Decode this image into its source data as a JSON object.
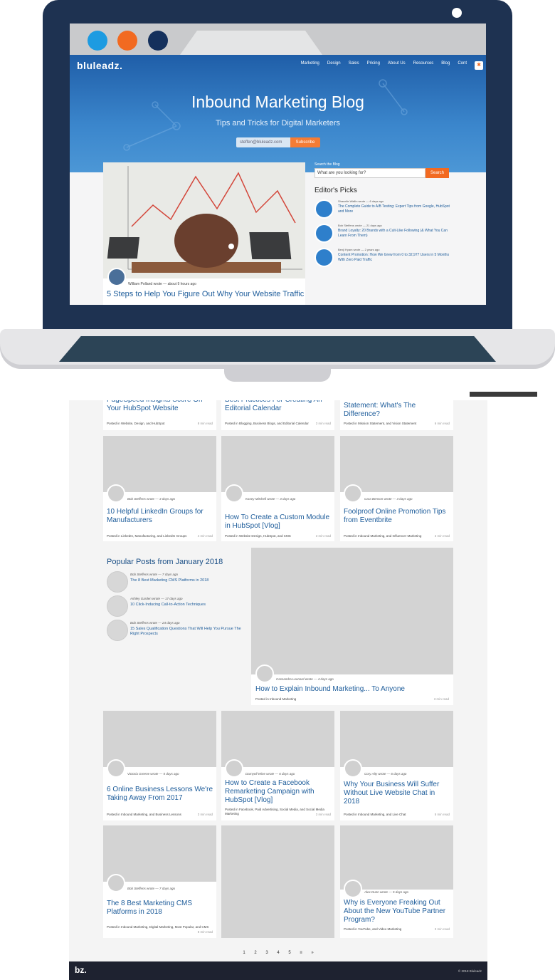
{
  "site": {
    "logo": "bluleadz.",
    "nav": [
      "Marketing",
      "Design",
      "Sales",
      "Pricing",
      "About Us",
      "Resources",
      "Blog",
      "Cont"
    ],
    "hub_icon": "hubspot-icon"
  },
  "hero": {
    "title": "Inbound Marketing Blog",
    "subtitle": "Tips and Tricks for Digital Marketers",
    "email_value": "steffen@bluleadz.com",
    "subscribe_label": "Subscribe"
  },
  "featured": {
    "byline": "William Polland wrote — about 9 hours ago",
    "title": "5 Steps to Help You Figure Out Why Your Website Traffic"
  },
  "sidebar": {
    "search_label": "Search the Blog",
    "search_placeholder": "What are you looking for?",
    "search_button": "Search",
    "picks_heading": "Editor's Picks",
    "picks": [
      {
        "author": "Shanelle Wallin wrote — 6 days ago",
        "title": "The Complete Guide to A/B Testing: Expert Tips from Google, HubSpot and More"
      },
      {
        "author": "Bob Steffens wrote — 21 days ago",
        "title": "Brand Loyalty: 20 Brands with a Cult-Like Following (& What You Can Learn From Them)"
      },
      {
        "author": "Benji Hyam wrote — 2 years ago",
        "title": "Content Promotion: How We Grew from 0 to 32,977 Users in 5 Months With Zero Paid Traffic"
      }
    ]
  },
  "top_row": [
    {
      "title": "PageSpeed Insights Score On Your HubSpot Website",
      "meta": "Posted in Website, Design, and HubSpot",
      "read": "8 min read"
    },
    {
      "title": "Best Practices For Creating An Editorial Calendar",
      "meta": "Posted in Blogging, Business Blogs, and Editorial Calendar",
      "read": "3 min read"
    },
    {
      "title": "Statement: What's The Difference?",
      "meta": "Posted in Mission Statement, and Vision Statement",
      "read": "6 min read"
    }
  ],
  "row2": [
    {
      "author": "Bob Steffens wrote — 3 days ago",
      "title": "10 Helpful LinkedIn Groups for Manufacturers",
      "meta": "Posted in LinkedIn, Manufacturing, and LinkedIn Groups",
      "read": "4 min read"
    },
    {
      "author": "Kasey Mitchell wrote — 3 days ago",
      "title": "How To Create a Custom Module in HubSpot [Vlog]",
      "meta": "Posted in Website Design, HubSpot, and CMS",
      "read": "3 min read"
    },
    {
      "author": "Cara Benson wrote — 3 days ago",
      "title": "Foolproof Online Promotion Tips from Eventbrite",
      "meta": "Posted in Inbound Marketing, and Influencer Marketing",
      "read": "3 min read"
    }
  ],
  "popular": {
    "heading": "Popular Posts from January 2018",
    "items": [
      {
        "author": "Bob Steffens wrote — 7 days ago",
        "title": "The 8 Best Marketing CMS Platforms in 2018"
      },
      {
        "author": "Ashley Garden wrote — 17 days ago",
        "title": "10 Click-Inducing Call-to-Action Techniques"
      },
      {
        "author": "Bob Steffens wrote — 24 days ago",
        "title": "15 Sales Qualification Questions That Will Help You Pursue The Right Prospects"
      }
    ]
  },
  "big_post": {
    "author": "Cassandra Leonard wrote — 4 days ago",
    "title": "How to Explain Inbound Marketing... To Anyone",
    "meta": "Posted in Inbound Marketing",
    "read": "3 min read"
  },
  "row3": [
    {
      "author": "Victoria Greene wrote — 5 days ago",
      "title": "6 Online Business Lessons We're Taking Away From 2017",
      "meta": "Posted in Inbound Marketing, and Business Lessons",
      "read": "3 min read"
    },
    {
      "author": "Darnyell Wine wrote — 6 days ago",
      "title": "How to Create a Facebook Remarketing Campaign with HubSpot [Vlog]",
      "meta": "Posted in Facebook, Paid Advertising, Social Media, and Social Media Marketing",
      "read": "3 min read"
    },
    {
      "author": "Cory Alty wrote — 6 days ago",
      "title": "Why Your Business Will Suffer Without Live Website Chat in 2018",
      "meta": "Posted in Inbound Marketing, and Live Chat",
      "read": "5 min read"
    }
  ],
  "row4": [
    {
      "author": "Bob Steffens wrote — 7 days ago",
      "title": "The 8 Best Marketing CMS Platforms in 2018",
      "meta": "Posted in Inbound Marketing, Digital Marketing, Most Popular, and CMS",
      "read": "8 min read"
    },
    {
      "author": "Alex Dunn wrote — 5 days ago",
      "title": "Why is Everyone Freaking Out About the New YouTube Partner Program?",
      "meta": "Posted in YouTube, and Video Marketing",
      "read": "3 min read"
    }
  ],
  "pager": [
    "1",
    "2",
    "3",
    "4",
    "5",
    "≡",
    "»"
  ],
  "footer": {
    "logo": "bz.",
    "copyright": "© 2018 Bluleadz"
  }
}
